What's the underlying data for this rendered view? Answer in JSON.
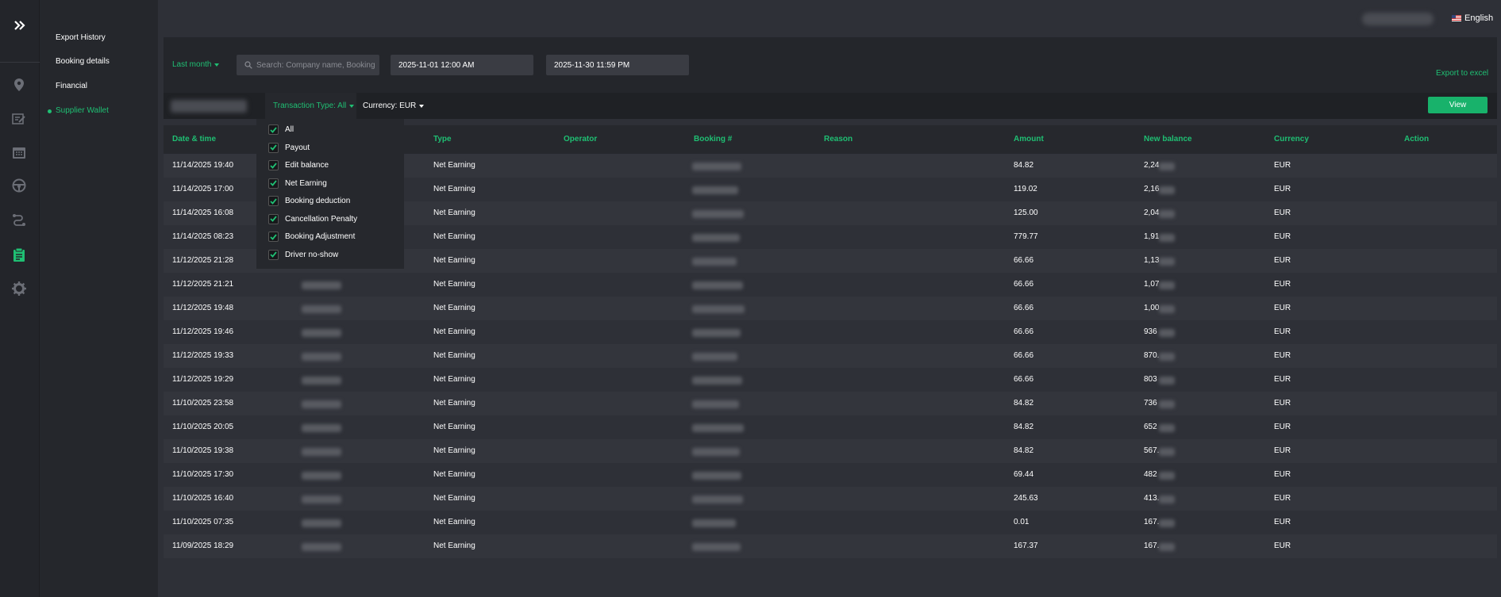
{
  "app": {
    "language": "English",
    "accent_color": "#1fbf73"
  },
  "sidebar": {
    "icons": [
      "expand-icon",
      "location-pin-icon",
      "edit-list-icon",
      "calendar-icon",
      "steering-wheel-icon",
      "route-icon",
      "clipboard-icon",
      "gear-icon"
    ],
    "items": [
      {
        "label": "Export History"
      },
      {
        "label": "Booking details"
      },
      {
        "label": "Financial"
      },
      {
        "label": "Supplier Wallet"
      }
    ]
  },
  "filters": {
    "period": "Last month",
    "search_placeholder": "Search: Company name, Booking",
    "date_from": "2025-11-01 12:00 AM",
    "date_to": "2025-11-30 11:59 PM",
    "export_label": "Export to excel",
    "transaction_type_label": "Transaction Type: All",
    "currency_label": "Currency: EUR",
    "view_label": "View"
  },
  "transaction_types": [
    {
      "label": "All",
      "checked": true
    },
    {
      "label": "Payout",
      "checked": true
    },
    {
      "label": "Edit balance",
      "checked": true
    },
    {
      "label": "Net Earning",
      "checked": true
    },
    {
      "label": "Booking deduction",
      "checked": true
    },
    {
      "label": "Cancellation Penalty",
      "checked": true
    },
    {
      "label": "Booking Adjustment",
      "checked": true
    },
    {
      "label": "Driver no-show",
      "checked": true
    }
  ],
  "table": {
    "headers": [
      "Date & time",
      "Type",
      "Operator",
      "Booking #",
      "Reason",
      "Amount",
      "New balance",
      "Currency",
      "Action"
    ],
    "rows": [
      {
        "datetime": "11/14/2025 19:40",
        "type": "Net Earning",
        "amount": "84.82",
        "balance": "2,24",
        "currency": "EUR"
      },
      {
        "datetime": "11/14/2025 17:00",
        "type": "Net Earning",
        "amount": "119.02",
        "balance": "2,16",
        "currency": "EUR"
      },
      {
        "datetime": "11/14/2025 16:08",
        "type": "Net Earning",
        "amount": "125.00",
        "balance": "2,04",
        "currency": "EUR"
      },
      {
        "datetime": "11/14/2025 08:23",
        "type": "Net Earning",
        "amount": "779.77",
        "balance": "1,91",
        "currency": "EUR"
      },
      {
        "datetime": "11/12/2025 21:28",
        "type": "Net Earning",
        "amount": "66.66",
        "balance": "1,13",
        "currency": "EUR"
      },
      {
        "datetime": "11/12/2025 21:21",
        "type": "Net Earning",
        "amount": "66.66",
        "balance": "1,07",
        "currency": "EUR"
      },
      {
        "datetime": "11/12/2025 19:48",
        "type": "Net Earning",
        "amount": "66.66",
        "balance": "1,00",
        "currency": "EUR"
      },
      {
        "datetime": "11/12/2025 19:46",
        "type": "Net Earning",
        "amount": "66.66",
        "balance": "936",
        "currency": "EUR"
      },
      {
        "datetime": "11/12/2025 19:33",
        "type": "Net Earning",
        "amount": "66.66",
        "balance": "870.",
        "currency": "EUR"
      },
      {
        "datetime": "11/12/2025 19:29",
        "type": "Net Earning",
        "amount": "66.66",
        "balance": "803",
        "currency": "EUR"
      },
      {
        "datetime": "11/10/2025 23:58",
        "type": "Net Earning",
        "amount": "84.82",
        "balance": "736",
        "currency": "EUR"
      },
      {
        "datetime": "11/10/2025 20:05",
        "type": "Net Earning",
        "amount": "84.82",
        "balance": "652",
        "currency": "EUR"
      },
      {
        "datetime": "11/10/2025 19:38",
        "type": "Net Earning",
        "amount": "84.82",
        "balance": "567.",
        "currency": "EUR"
      },
      {
        "datetime": "11/10/2025 17:30",
        "type": "Net Earning",
        "amount": "69.44",
        "balance": "482",
        "currency": "EUR"
      },
      {
        "datetime": "11/10/2025 16:40",
        "type": "Net Earning",
        "amount": "245.63",
        "balance": "413.",
        "currency": "EUR"
      },
      {
        "datetime": "11/10/2025 07:35",
        "type": "Net Earning",
        "amount": "0.01",
        "balance": "167.",
        "currency": "EUR"
      },
      {
        "datetime": "11/09/2025 18:29",
        "type": "Net Earning",
        "amount": "167.37",
        "balance": "167.",
        "currency": "EUR"
      }
    ]
  }
}
